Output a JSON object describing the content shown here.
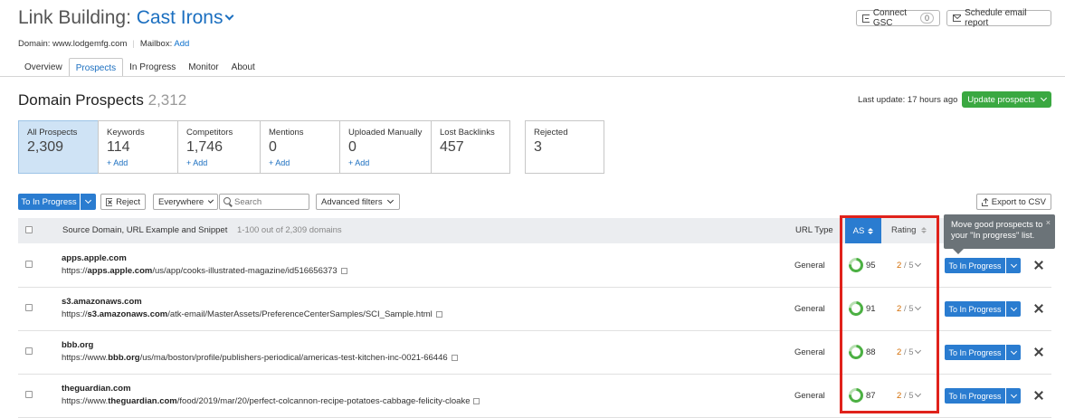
{
  "header": {
    "title_prefix": "Link Building: ",
    "project_name": "Cast Irons",
    "connect_gsc": "Connect GSC",
    "gsc_count": "0",
    "schedule_email": "Schedule email report"
  },
  "meta": {
    "domain_label": "Domain: www.lodgemfg.com",
    "mailbox_label": "Mailbox:",
    "mailbox_add": "Add"
  },
  "tabs": [
    "Overview",
    "Prospects",
    "In Progress",
    "Monitor",
    "About"
  ],
  "active_tab": "Prospects",
  "section": {
    "title": "Domain Prospects",
    "count": "2,312",
    "last_update": "Last update: 17 hours ago",
    "update_button": "Update prospects"
  },
  "cards": [
    {
      "label": "All Prospects",
      "value": "2,309",
      "add": ""
    },
    {
      "label": "Keywords",
      "value": "114",
      "add": "+ Add"
    },
    {
      "label": "Competitors",
      "value": "1,746",
      "add": "+ Add"
    },
    {
      "label": "Mentions",
      "value": "0",
      "add": "+ Add"
    },
    {
      "label": "Uploaded Manually",
      "value": "0",
      "add": "+ Add"
    },
    {
      "label": "Lost Backlinks",
      "value": "457",
      "add": ""
    },
    {
      "label": "Rejected",
      "value": "3",
      "add": ""
    }
  ],
  "toolbar": {
    "to_in_progress": "To In Progress",
    "reject": "Reject",
    "everywhere": "Everywhere",
    "search_placeholder": "Search",
    "advanced_filters": "Advanced filters",
    "export_csv": "Export to CSV"
  },
  "table": {
    "col_source": "Source Domain, URL Example and Snippet",
    "range_text": "1-100 out of 2,309 domains",
    "col_url_type": "URL Type",
    "col_as": "AS",
    "col_rating": "Rating",
    "rows": [
      {
        "domain": "apps.apple.com",
        "url_pre": "https://",
        "url_bold": "apps.apple.com",
        "url_post": "/us/app/cooks-illustrated-magazine/id516656373",
        "url_type": "General",
        "as": "95",
        "rating": "2",
        "rating_of": "/ 5",
        "action": "To In Progress"
      },
      {
        "domain": "s3.amazonaws.com",
        "url_pre": "https://",
        "url_bold": "s3.amazonaws.com",
        "url_post": "/atk-email/MasterAssets/PreferenceCenterSamples/SCI_Sample.html",
        "url_type": "General",
        "as": "91",
        "rating": "2",
        "rating_of": "/ 5",
        "action": "To In Progress"
      },
      {
        "domain": "bbb.org",
        "url_pre": "https://www.",
        "url_bold": "bbb.org",
        "url_post": "/us/ma/boston/profile/publishers-periodical/americas-test-kitchen-inc-0021-66446",
        "url_type": "General",
        "as": "88",
        "rating": "2",
        "rating_of": "/ 5",
        "action": "To In Progress"
      },
      {
        "domain": "theguardian.com",
        "url_pre": "https://www.",
        "url_bold": "theguardian.com",
        "url_post": "/food/2019/mar/20/perfect-colcannon-recipe-potatoes-cabbage-felicity-cloake",
        "url_type": "General",
        "as": "87",
        "rating": "2",
        "rating_of": "/ 5",
        "action": "To In Progress"
      }
    ]
  },
  "tooltip": {
    "text": "Move good prospects to your \"In progress\" list.",
    "close": "×"
  },
  "colors": {
    "accent_blue": "#2a7cd0",
    "update_green": "#3aa841",
    "highlight_red": "#e0221b",
    "rating_orange": "#d36b00",
    "as_ring_green": "#4cb043"
  }
}
